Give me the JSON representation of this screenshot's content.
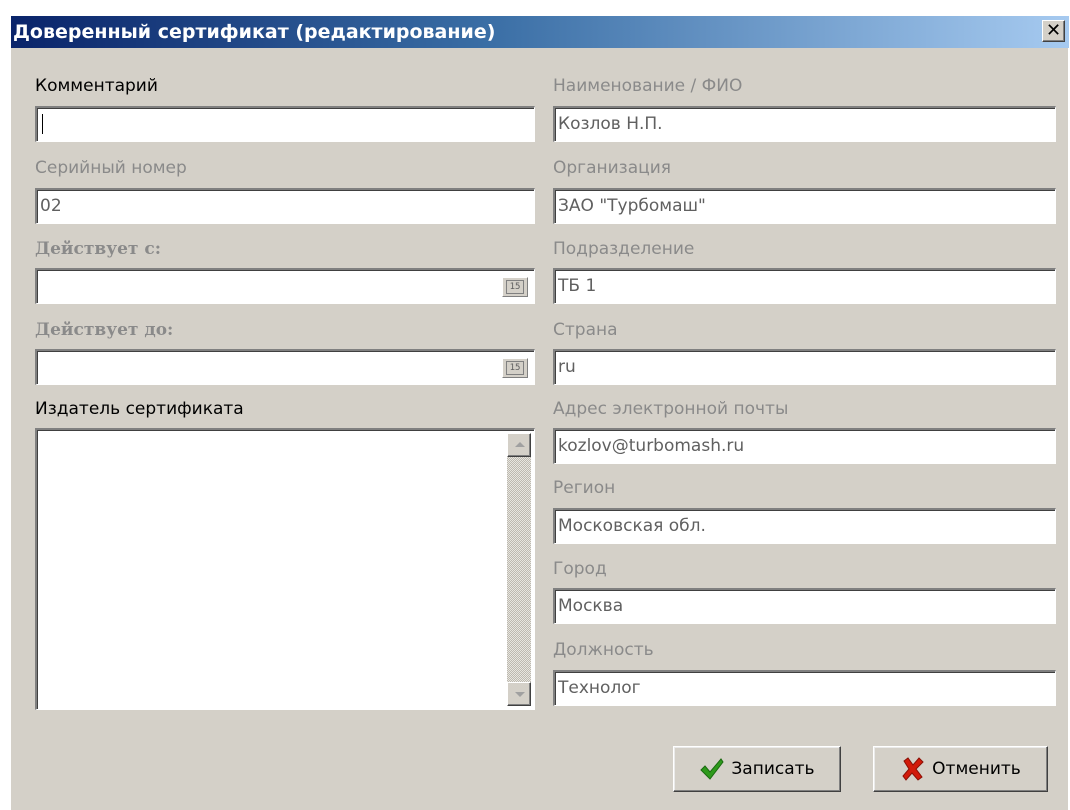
{
  "window": {
    "title": "Доверенный сертификат (редактирование)",
    "close_glyph": "✕"
  },
  "left": {
    "comment": {
      "label": "Комментарий",
      "value": ""
    },
    "serial": {
      "label": "Серийный номер",
      "value": "02"
    },
    "valid_from": {
      "label": "Действует с:",
      "value": "",
      "calendar_text": "15"
    },
    "valid_to": {
      "label": "Действует до:",
      "value": "",
      "calendar_text": "15"
    },
    "issuer": {
      "label": "Издатель сертификата",
      "value": ""
    }
  },
  "right": {
    "name": {
      "label": "Наименование / ФИО",
      "value": "Козлов Н.П."
    },
    "org": {
      "label": "Организация",
      "value": "ЗАО \"Турбомаш\""
    },
    "dept": {
      "label": "Подразделение",
      "value": "ТБ 1"
    },
    "country": {
      "label": "Страна",
      "value": "ru"
    },
    "email": {
      "label": "Адрес электронной почты",
      "value": "kozlov@turbomash.ru"
    },
    "region": {
      "label": "Регион",
      "value": "Московская обл."
    },
    "city": {
      "label": "Город",
      "value": "Москва"
    },
    "position": {
      "label": "Должность",
      "value": "Технолог"
    }
  },
  "buttons": {
    "save": {
      "label": "Записать",
      "icon": "checkmark-icon",
      "color": "#2e9a1c"
    },
    "cancel": {
      "label": "Отменить",
      "icon": "x-cross-icon",
      "color": "#d21a0a"
    }
  }
}
